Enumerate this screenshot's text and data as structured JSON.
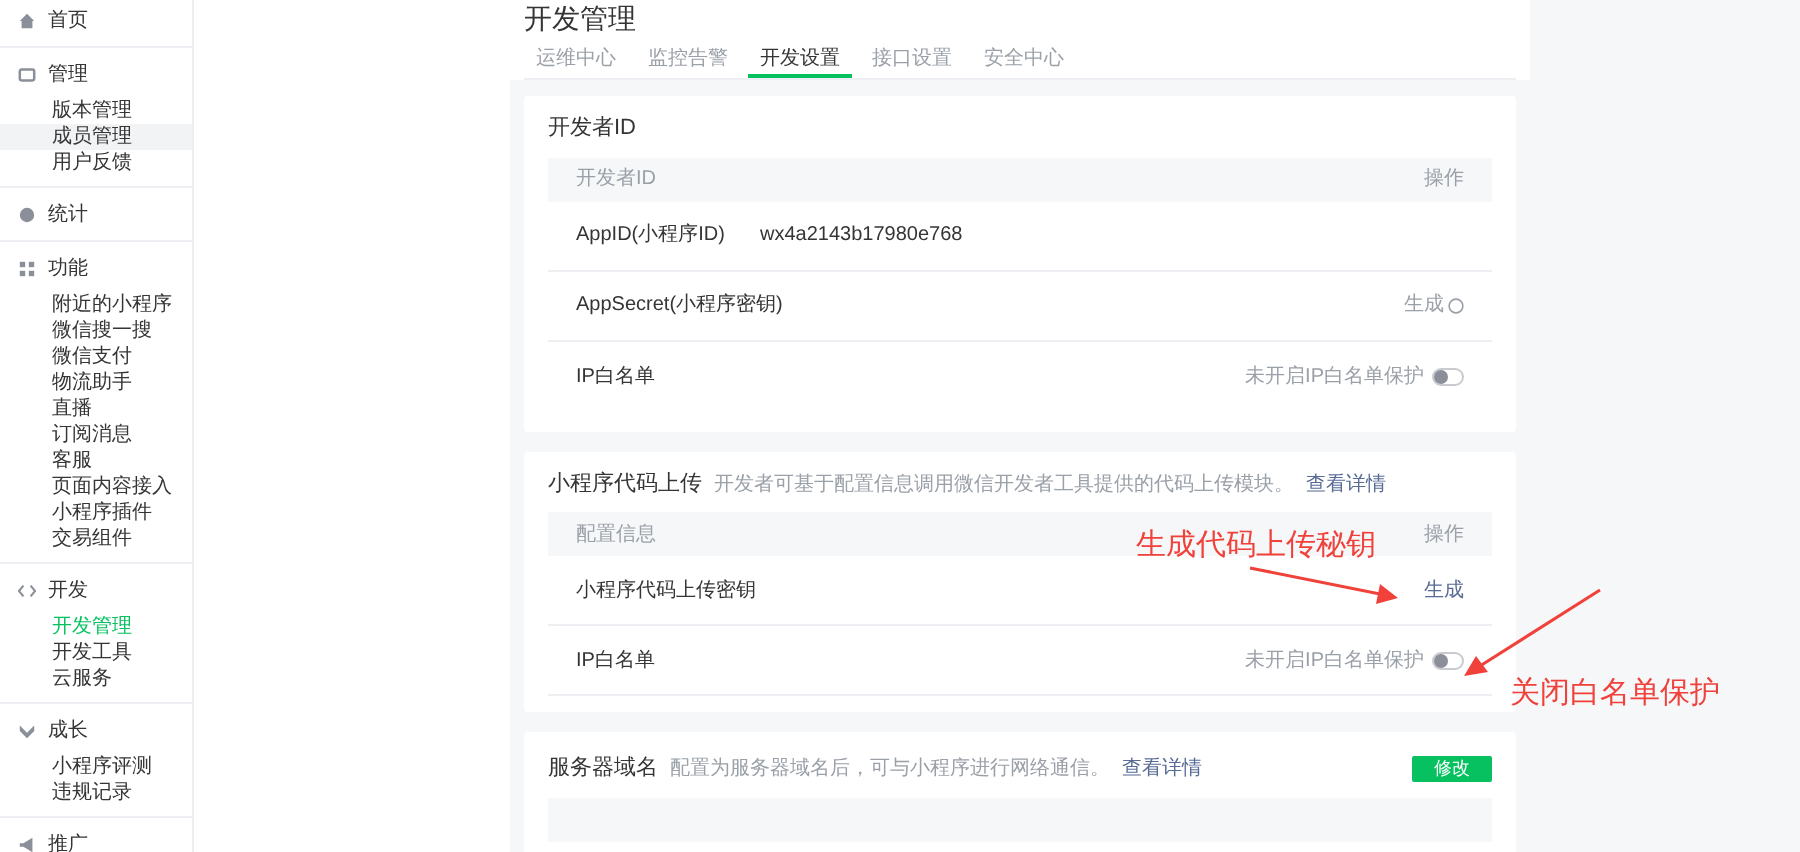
{
  "sidebar": {
    "sections": [
      {
        "title": "首页"
      },
      {
        "title": "管理",
        "items": [
          {
            "label": "版本管理",
            "selected": false,
            "highlighted": false
          },
          {
            "label": "成员管理",
            "selected": false,
            "highlighted": true
          },
          {
            "label": "用户反馈",
            "selected": false,
            "highlighted": false
          }
        ]
      },
      {
        "title": "统计"
      },
      {
        "title": "功能",
        "items": [
          {
            "label": "附近的小程序",
            "selected": false,
            "highlighted": false
          },
          {
            "label": "微信搜一搜",
            "selected": false,
            "highlighted": false
          },
          {
            "label": "微信支付",
            "selected": false,
            "highlighted": false
          },
          {
            "label": "物流助手",
            "selected": false,
            "highlighted": false
          },
          {
            "label": "直播",
            "selected": false,
            "highlighted": false
          },
          {
            "label": "订阅消息",
            "selected": false,
            "highlighted": false
          },
          {
            "label": "客服",
            "selected": false,
            "highlighted": false
          },
          {
            "label": "页面内容接入",
            "selected": false,
            "highlighted": false
          },
          {
            "label": "小程序插件",
            "selected": false,
            "highlighted": false
          },
          {
            "label": "交易组件",
            "selected": false,
            "highlighted": false
          }
        ]
      },
      {
        "title": "开发",
        "items": [
          {
            "label": "开发管理",
            "selected": true,
            "highlighted": false
          },
          {
            "label": "开发工具",
            "selected": false,
            "highlighted": false
          },
          {
            "label": "云服务",
            "selected": false,
            "highlighted": false
          }
        ]
      },
      {
        "title": "成长",
        "items": [
          {
            "label": "小程序评测",
            "selected": false,
            "highlighted": false
          },
          {
            "label": "违规记录",
            "selected": false,
            "highlighted": false
          }
        ]
      },
      {
        "title": "推广"
      }
    ]
  },
  "page_title": "开发管理",
  "tabs": [
    {
      "label": "运维中心",
      "selected": false
    },
    {
      "label": "监控告警",
      "selected": false
    },
    {
      "label": "开发设置",
      "selected": true
    },
    {
      "label": "接口设置",
      "selected": false
    },
    {
      "label": "安全中心",
      "selected": false
    }
  ],
  "developer_id": {
    "title": "开发者ID",
    "columns": [
      "开发者ID",
      "操作"
    ],
    "rows": [
      {
        "kind": "value",
        "label": "AppID(小程序ID)",
        "value": "wx4a2143b17980e768"
      },
      {
        "kind": "action",
        "label": "AppSecret(小程序密钥)",
        "action": "生成"
      },
      {
        "kind": "toggle",
        "label": "IP白名单",
        "status": "未开启IP白名单保护",
        "on": false
      }
    ]
  },
  "code_upload": {
    "title": "小程序代码上传",
    "description": "开发者可基于配置信息调用微信开发者工具提供的代码上传模块。",
    "link": "查看详情",
    "columns": [
      "配置信息",
      "操作"
    ],
    "rows": [
      {
        "kind": "link",
        "label": "小程序代码上传密钥",
        "action": "生成"
      },
      {
        "kind": "toggle",
        "label": "IP白名单",
        "status": "未开启IP白名单保护",
        "on": false
      }
    ]
  },
  "server_domain": {
    "title": "服务器域名",
    "description": "配置为服务器域名后，可与小程序进行网络通信。",
    "link": "查看详情",
    "button": "修改"
  },
  "annotations": [
    "生成代码上传秘钥",
    "关闭白名单保护"
  ]
}
